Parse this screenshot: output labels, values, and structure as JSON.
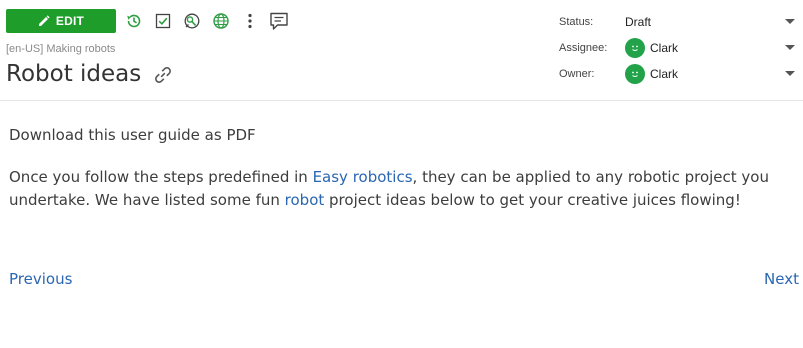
{
  "toolbar": {
    "edit_label": "EDIT",
    "icons": [
      "pencil-icon",
      "history-icon",
      "checkbox-icon",
      "review-icon",
      "globe-icon",
      "more-icon",
      "comment-icon"
    ]
  },
  "breadcrumb": "[en-US] Making robots",
  "title": "Robot ideas",
  "properties": {
    "status_label": "Status:",
    "status_value": "Draft",
    "assignee_label": "Assignee:",
    "assignee_value": "Clark",
    "owner_label": "Owner:",
    "owner_value": "Clark"
  },
  "content": {
    "download_link": "Download this user guide as PDF",
    "para_part1": "Once you follow the steps predefined in ",
    "link_easy_robotics": "Easy robotics",
    "para_part2": ", they can be applied to any robotic project you undertake. We have listed some fun ",
    "link_robot": "robot",
    "para_part3": " project ideas below to get your creative juices flowing!"
  },
  "nav": {
    "previous": "Previous",
    "next": "Next"
  },
  "colors": {
    "accent_green": "#1f9d2b",
    "link_blue": "#2a66b1",
    "avatar_green": "#22a34a"
  }
}
